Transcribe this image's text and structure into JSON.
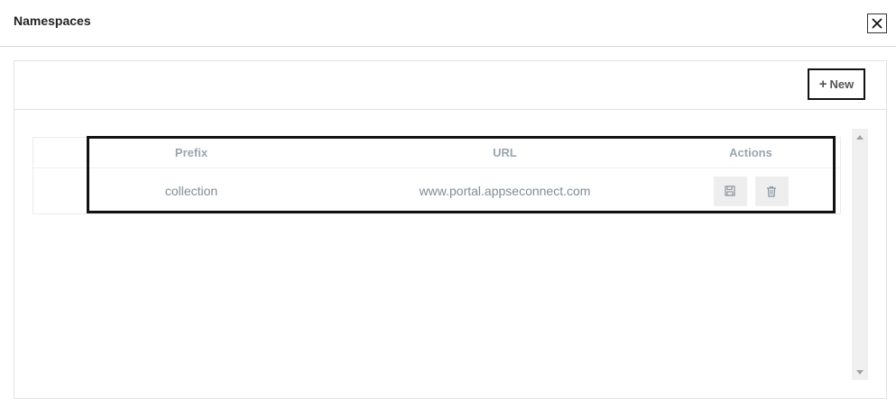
{
  "modal": {
    "title": "Namespaces",
    "close_icon": "close-icon"
  },
  "toolbar": {
    "new_label": "New",
    "new_icon": "plus-icon"
  },
  "table": {
    "headers": [
      "Prefix",
      "URL",
      "Actions"
    ],
    "rows": [
      {
        "prefix": "collection",
        "url": "www.portal.appseconnect.com",
        "actions": [
          "save-icon",
          "trash-icon"
        ]
      }
    ]
  },
  "colors": {
    "header_text": "#98a6ad",
    "cell_text": "#7f8c95",
    "action_bg": "#eeeeee",
    "highlight_border": "#111111"
  }
}
